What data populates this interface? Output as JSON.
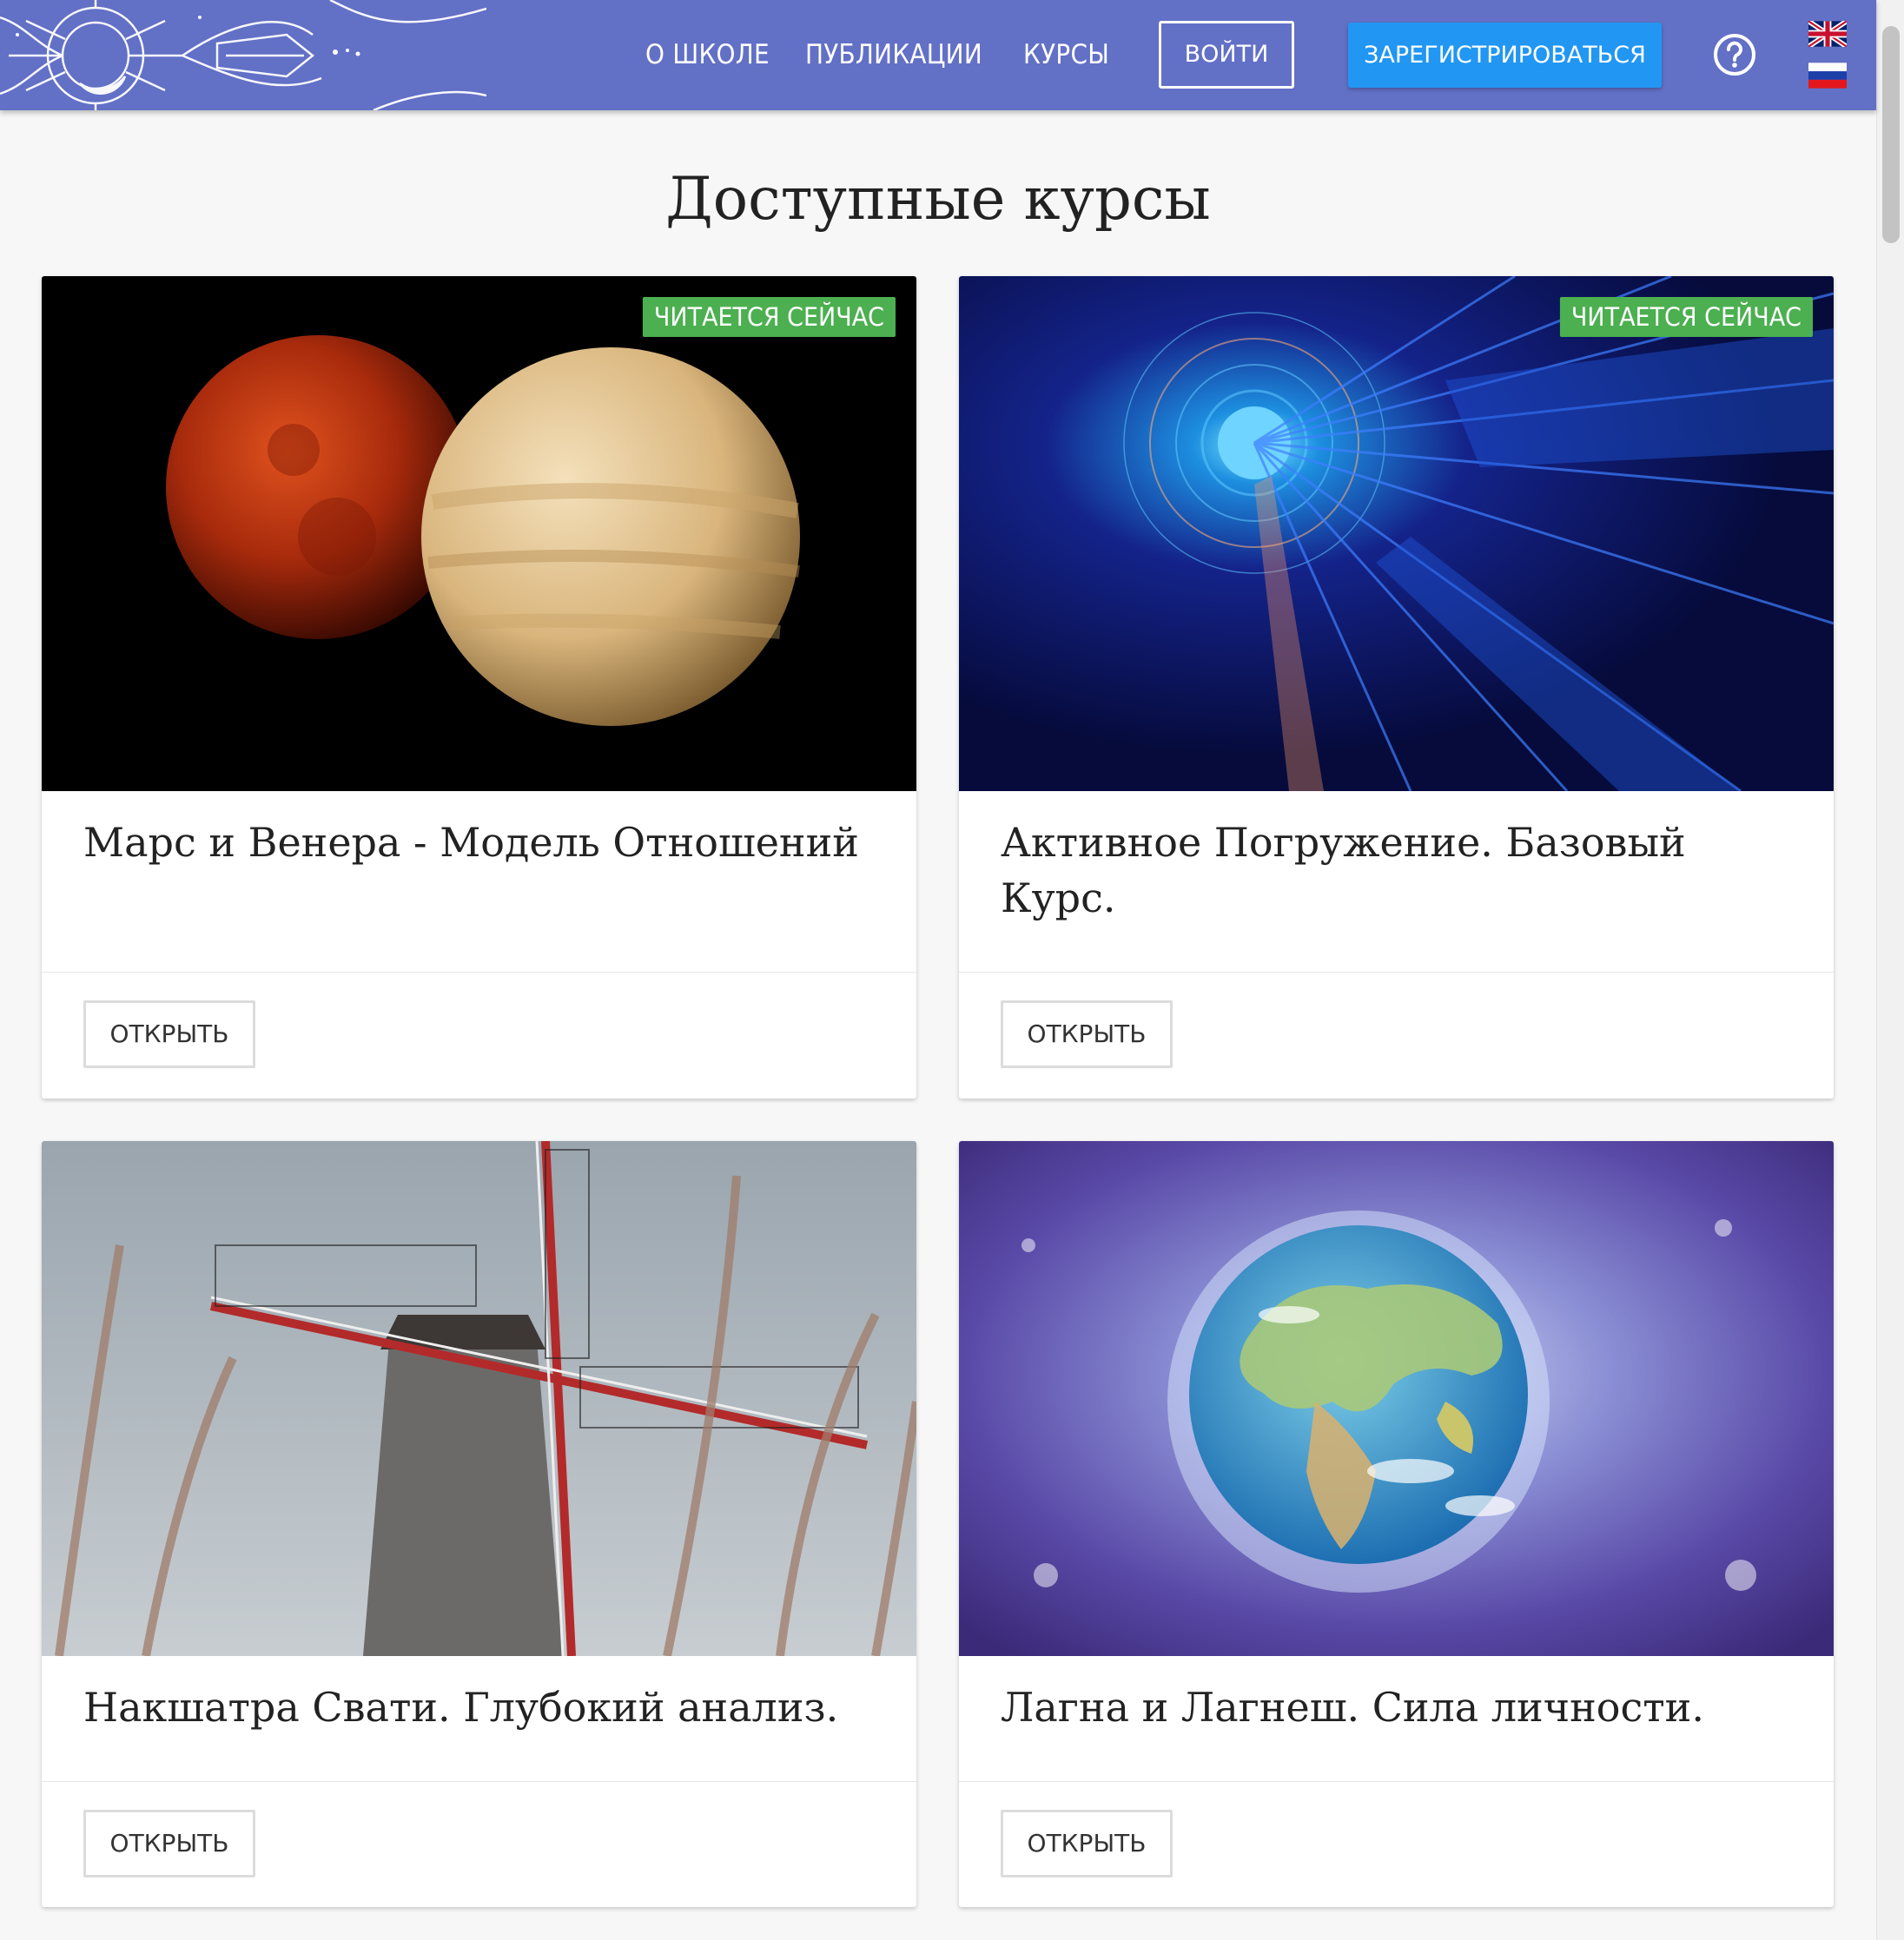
{
  "header": {
    "nav": [
      {
        "label": "О ШКОЛЕ"
      },
      {
        "label": "ПУБЛИКАЦИИ"
      },
      {
        "label": "КУРСЫ"
      }
    ],
    "login_label": "ВОЙТИ",
    "register_label": "ЗАРЕГИСТРИРОВАТЬСЯ",
    "help_icon": "help-circle-icon",
    "languages": [
      "en-flag",
      "ru-flag"
    ],
    "colors": {
      "bar": "#6270c6",
      "register": "#2196f3"
    }
  },
  "main": {
    "title": "Доступные курсы",
    "courses": [
      {
        "title": "Марс и Венера - Модель Отношений",
        "badge": "ЧИТАЕТСЯ СЕЙЧАС",
        "action": "ОТКРЫТЬ",
        "image": "mars-venus-planets"
      },
      {
        "title": "Активное Погружение. Базовый Курс.",
        "badge": "ЧИТАЕТСЯ СЕЙЧАС",
        "action": "ОТКРЫТЬ",
        "image": "blue-abstract-portal"
      },
      {
        "title": "Накшатра Свати. Глубокий анализ.",
        "action": "ОТКРЫТЬ",
        "image": "windmill-reeds"
      },
      {
        "title": "Лагна и Лагнеш. Сила личности.",
        "action": "ОТКРЫТЬ",
        "image": "watercolor-earth"
      }
    ],
    "badge_color": "#4caf50"
  }
}
